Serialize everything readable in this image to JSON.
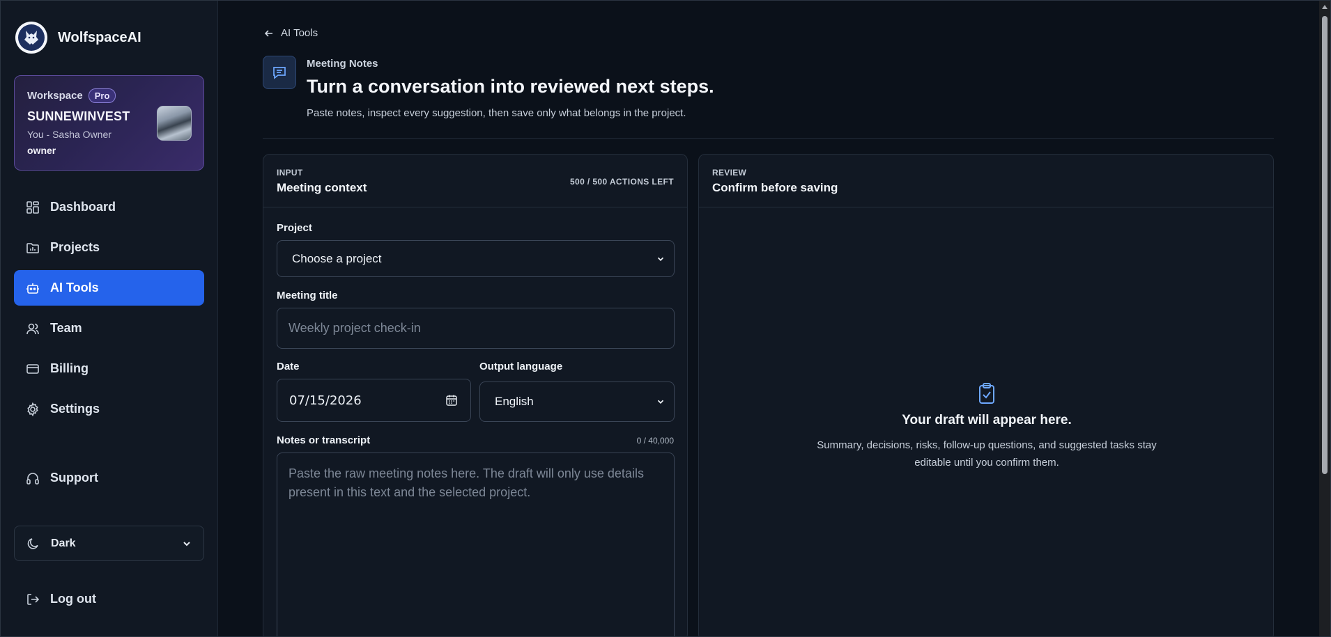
{
  "app": {
    "name": "WolfspaceAI"
  },
  "workspace": {
    "label": "Workspace",
    "plan_badge": "Pro",
    "name": "SUNNEWINVEST",
    "user_line": "You - Sasha Owner",
    "role": "owner"
  },
  "sidebar": {
    "items": [
      {
        "label": "Dashboard",
        "icon": "dashboard-icon"
      },
      {
        "label": "Projects",
        "icon": "folder-icon"
      },
      {
        "label": "AI Tools",
        "icon": "robot-icon",
        "active": true
      },
      {
        "label": "Team",
        "icon": "users-icon"
      },
      {
        "label": "Billing",
        "icon": "credit-card-icon"
      },
      {
        "label": "Settings",
        "icon": "gear-icon"
      }
    ],
    "support": {
      "label": "Support",
      "icon": "headphones-icon"
    },
    "theme": {
      "label": "Dark",
      "icon": "moon-icon"
    },
    "logout": {
      "label": "Log out",
      "icon": "logout-icon"
    }
  },
  "header": {
    "back_label": "AI Tools",
    "eyebrow": "Meeting Notes",
    "title": "Turn a conversation into reviewed next steps.",
    "subtitle": "Paste notes, inspect every suggestion, then save only what belongs in the project."
  },
  "input_panel": {
    "eyebrow": "INPUT",
    "title": "Meeting context",
    "actions_left": "500 / 500 ACTIONS LEFT",
    "project": {
      "label": "Project",
      "value": "Choose a project"
    },
    "meeting_title": {
      "label": "Meeting title",
      "placeholder": "Weekly project check-in"
    },
    "date": {
      "label": "Date",
      "value": "07/15/2026"
    },
    "output_language": {
      "label": "Output language",
      "value": "English"
    },
    "notes": {
      "label": "Notes or transcript",
      "counter": "0 / 40,000",
      "placeholder": "Paste the raw meeting notes here. The draft will only use details present in this text and the selected project."
    }
  },
  "review_panel": {
    "eyebrow": "REVIEW",
    "title": "Confirm before saving",
    "empty_title": "Your draft will appear here.",
    "empty_desc": "Summary, decisions, risks, follow-up questions, and suggested tasks stay editable until you confirm them."
  },
  "colors": {
    "accent": "#2563eb",
    "background": "#0b111a",
    "panel": "#111823",
    "workspace_border": "#5b4a9a"
  }
}
